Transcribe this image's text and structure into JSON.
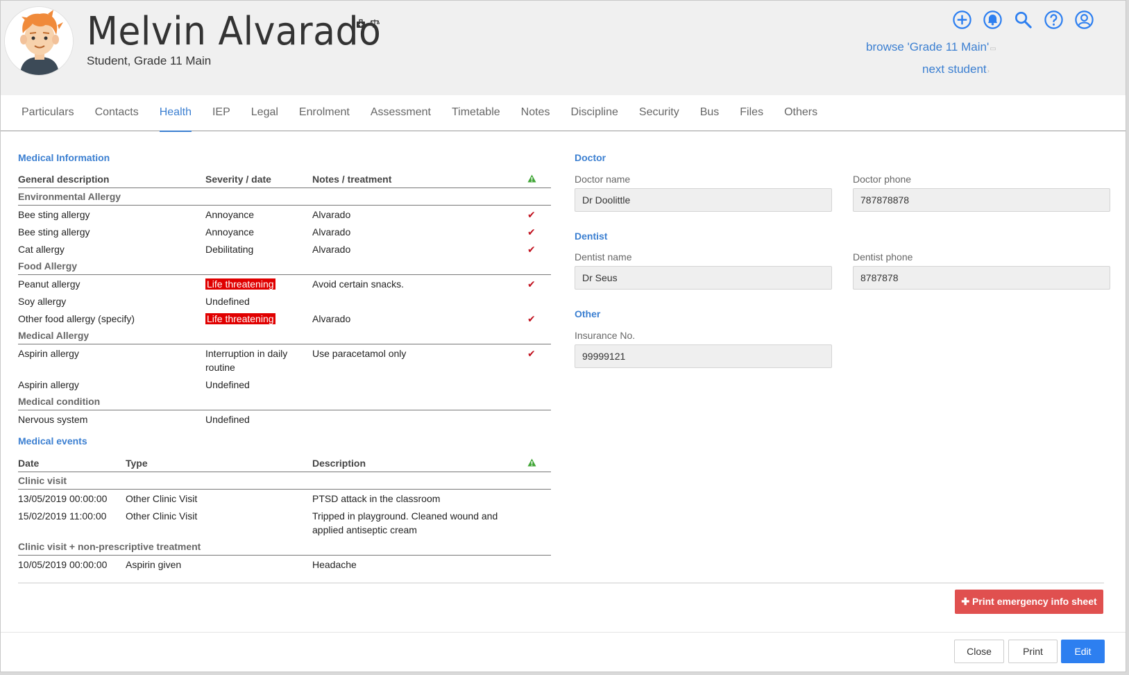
{
  "header": {
    "name": "Melvin Alvarado",
    "subtitle": "Student, Grade 11 Main",
    "browse_link": "browse 'Grade 11 Main'",
    "next_link": "next student",
    "icons": [
      "add-icon",
      "bell-icon",
      "search-icon",
      "help-icon",
      "user-icon"
    ],
    "name_icons": [
      "medical-kit-icon",
      "scales-icon"
    ]
  },
  "tabs": [
    "Particulars",
    "Contacts",
    "Health",
    "IEP",
    "Legal",
    "Enrolment",
    "Assessment",
    "Timetable",
    "Notes",
    "Discipline",
    "Security",
    "Bus",
    "Files",
    "Others"
  ],
  "active_tab": "Health",
  "medical_info": {
    "title": "Medical Information",
    "columns": [
      "General description",
      "Severity / date",
      "Notes / treatment"
    ],
    "groups": [
      {
        "name": "Environmental Allergy",
        "rows": [
          {
            "desc": "Bee sting allergy",
            "severity": "Annoyance",
            "notes": "Alvarado",
            "check": true,
            "severe": false
          },
          {
            "desc": "Bee sting allergy",
            "severity": "Annoyance",
            "notes": "Alvarado",
            "check": true,
            "severe": false
          },
          {
            "desc": "Cat allergy",
            "severity": "Debilitating",
            "notes": "Alvarado",
            "check": true,
            "severe": false
          }
        ]
      },
      {
        "name": "Food Allergy",
        "rows": [
          {
            "desc": "Peanut allergy",
            "severity": "Life threatening",
            "notes": "Avoid certain snacks.",
            "check": true,
            "severe": true
          },
          {
            "desc": "Soy allergy",
            "severity": "Undefined",
            "notes": "",
            "check": false,
            "severe": false
          },
          {
            "desc": "Other food allergy (specify)",
            "severity": "Life threatening",
            "notes": "Alvarado",
            "check": true,
            "severe": true
          }
        ]
      },
      {
        "name": "Medical Allergy",
        "rows": [
          {
            "desc": "Aspirin allergy",
            "severity": "Interruption in daily routine",
            "notes": "Use paracetamol only",
            "check": true,
            "severe": false
          },
          {
            "desc": "Aspirin allergy",
            "severity": "Undefined",
            "notes": "",
            "check": false,
            "severe": false
          }
        ]
      },
      {
        "name": "Medical condition",
        "rows": [
          {
            "desc": "Nervous system",
            "severity": "Undefined",
            "notes": "",
            "check": false,
            "severe": false
          }
        ]
      }
    ]
  },
  "medical_events": {
    "title": "Medical events",
    "columns": [
      "Date",
      "Type",
      "Description"
    ],
    "groups": [
      {
        "name": "Clinic visit",
        "rows": [
          {
            "date": "13/05/2019 00:00:00",
            "type": "Other Clinic Visit",
            "desc": "PTSD attack in the classroom"
          },
          {
            "date": "15/02/2019 11:00:00",
            "type": "Other Clinic Visit",
            "desc": "Tripped in playground. Cleaned wound and applied antiseptic cream"
          }
        ]
      },
      {
        "name": "Clinic visit + non-prescriptive treatment",
        "rows": [
          {
            "date": "10/05/2019 00:00:00",
            "type": "Aspirin given",
            "desc": "Headache"
          }
        ]
      }
    ]
  },
  "doctor": {
    "title": "Doctor",
    "name_label": "Doctor name",
    "name_value": "Dr Doolittle",
    "phone_label": "Doctor phone",
    "phone_value": "787878878"
  },
  "dentist": {
    "title": "Dentist",
    "name_label": "Dentist name",
    "name_value": "Dr Seus",
    "phone_label": "Dentist phone",
    "phone_value": "8787878"
  },
  "other": {
    "title": "Other",
    "insurance_label": "Insurance No.",
    "insurance_value": "99999121"
  },
  "buttons": {
    "print_emergency": "✚ Print emergency info sheet",
    "close": "Close",
    "print": "Print",
    "edit": "Edit"
  },
  "colors": {
    "accent": "#3b7fd1",
    "danger": "#e0504f",
    "primary": "#2d7ff0",
    "severe_bg": "#e00000"
  }
}
